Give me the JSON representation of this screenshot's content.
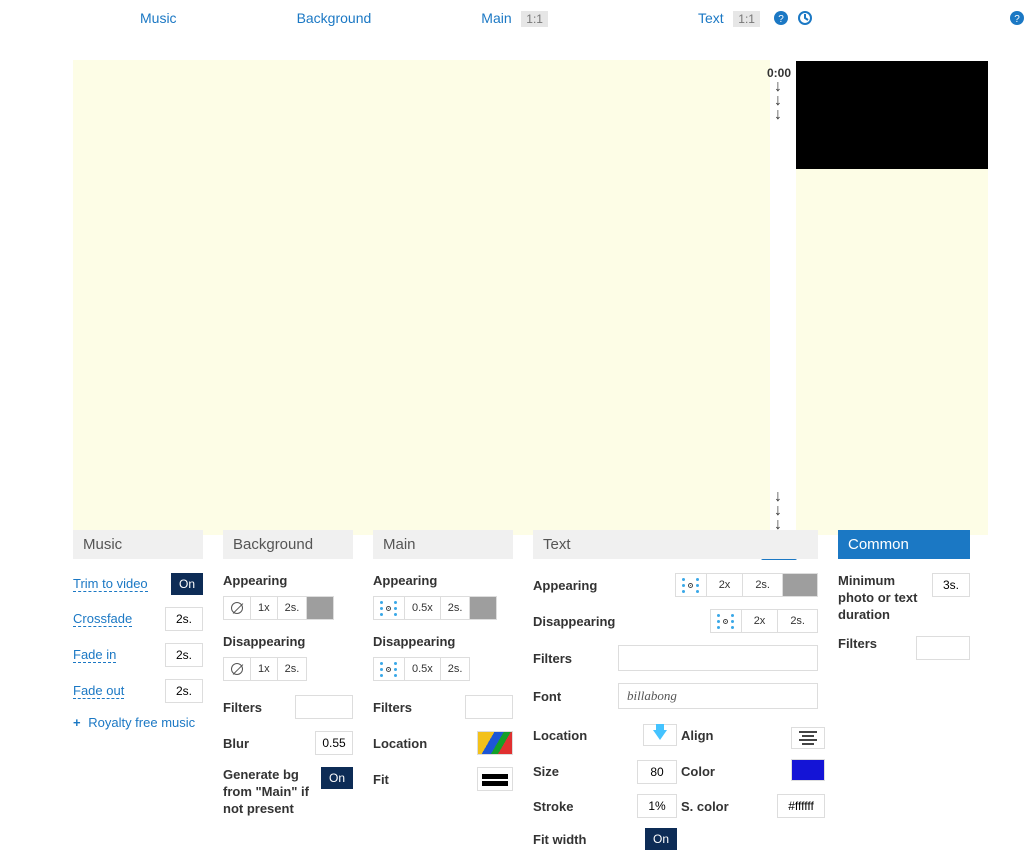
{
  "tabs": {
    "music": "Music",
    "background": "Background",
    "main": "Main",
    "text": "Text",
    "ratio": "1:1"
  },
  "stage": {
    "time_top": "0:00",
    "time_badge": "0:00"
  },
  "music": {
    "heading": "Music",
    "trim_label": "Trim to video",
    "trim_value": "On",
    "crossfade_label": "Crossfade",
    "crossfade_value": "2s.",
    "fadein_label": "Fade in",
    "fadein_value": "2s.",
    "fadeout_label": "Fade out",
    "fadeout_value": "2s.",
    "royalty_label": "Royalty free music"
  },
  "bg": {
    "heading": "Background",
    "appearing": "Appearing",
    "disappearing": "Disappearing",
    "seg_speed": "1x",
    "seg_dur": "2s.",
    "filters_label": "Filters",
    "blur_label": "Blur",
    "blur_value": "0.55",
    "generate_label": "Generate bg from \"Main\" if not present",
    "generate_value": "On"
  },
  "main": {
    "heading": "Main",
    "appearing": "Appearing",
    "disappearing": "Disappearing",
    "seg_speed": "0.5x",
    "seg_dur": "2s.",
    "filters_label": "Filters",
    "location_label": "Location",
    "fit_label": "Fit"
  },
  "text": {
    "heading": "Text",
    "appearing": "Appearing",
    "disappearing": "Disappearing",
    "seg_speed": "2x",
    "seg_dur": "2s.",
    "filters_label": "Filters",
    "font_label": "Font",
    "font_preview": "billabong",
    "location_label": "Location",
    "align_label": "Align",
    "size_label": "Size",
    "size_value": "80",
    "color_label": "Color",
    "stroke_label": "Stroke",
    "stroke_value": "1%",
    "scolor_label": "S. color",
    "scolor_value": "#ffffff",
    "fitwidth_label": "Fit width",
    "fitwidth_value": "On"
  },
  "common": {
    "heading": "Common",
    "minduration_label": "Minimum photo or text duration",
    "minduration_value": "3s.",
    "filters_label": "Filters"
  }
}
